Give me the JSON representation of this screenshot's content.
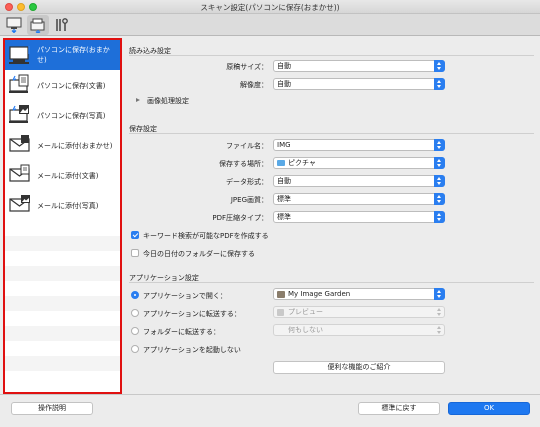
{
  "window": {
    "title": "スキャン設定(パソコンに保存(おまかせ))"
  },
  "toolbar": {
    "icons": [
      "scan-from-computer-icon",
      "scan-from-panel-icon",
      "general-settings-icon"
    ]
  },
  "sidebar": {
    "items": [
      {
        "label": "パソコンに保存(おまかせ)",
        "icon": "computer-save-icon",
        "selected": true
      },
      {
        "label": "パソコンに保存(文書)",
        "icon": "computer-document-icon",
        "selected": false
      },
      {
        "label": "パソコンに保存(写真)",
        "icon": "computer-photo-icon",
        "selected": false
      },
      {
        "label": "メールに添付(おまかせ)",
        "icon": "mail-attach-icon",
        "selected": false
      },
      {
        "label": "メールに添付(文書)",
        "icon": "mail-document-icon",
        "selected": false
      },
      {
        "label": "メールに添付(写真)",
        "icon": "mail-photo-icon",
        "selected": false
      }
    ]
  },
  "scan_settings": {
    "heading": "読み込み設定",
    "paper_size": {
      "label": "原稿サイズ：",
      "value": "自動"
    },
    "resolution": {
      "label": "解像度：",
      "value": "自動"
    },
    "image_processing": "画像処理設定"
  },
  "save_settings": {
    "heading": "保存設定",
    "file_name": {
      "label": "ファイル名：",
      "value": "IMG"
    },
    "save_in": {
      "label": "保存する場所：",
      "value": "ピクチャ"
    },
    "data_format": {
      "label": "データ形式：",
      "value": "自動"
    },
    "jpeg_quality": {
      "label": "JPEG画質：",
      "value": "標準"
    },
    "pdf_compression": {
      "label": "PDF圧縮タイプ：",
      "value": "標準"
    },
    "keyword_pdf": {
      "label": "キーワード検索が可能なPDFを作成する",
      "checked": true
    },
    "date_folder": {
      "label": "今日の日付のフォルダーに保存する",
      "checked": false
    }
  },
  "app_settings": {
    "heading": "アプリケーション設定",
    "open_with": {
      "label": "アプリケーションで開く：",
      "value": "My Image Garden",
      "selected": true
    },
    "send_to_app": {
      "label": "アプリケーションに転送する：",
      "value": "プレビュー",
      "selected": false
    },
    "send_to_folder": {
      "label": "フォルダーに転送する：",
      "value": "何もしない",
      "selected": false
    },
    "do_not_start": {
      "label": "アプリケーションを起動しない",
      "selected": false
    },
    "more_functions": "便利な機能のご紹介"
  },
  "footer": {
    "instructions": "操作説明",
    "defaults": "標準に戻す",
    "ok": "OK"
  },
  "colors": {
    "accent": "#1e78f0",
    "highlight_border": "#e01010",
    "selection": "#1e6fd9"
  }
}
